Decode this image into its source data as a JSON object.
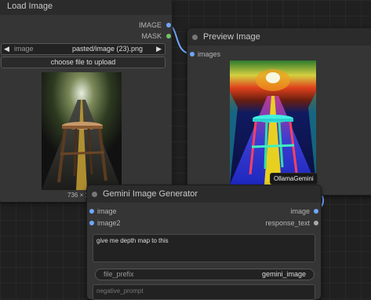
{
  "load_image": {
    "title": "Load Image",
    "outputs": [
      "IMAGE",
      "MASK"
    ],
    "image_widget_label": "image",
    "image_widget_value": "pasted/image (23).png",
    "upload_button": "choose file to upload",
    "size_label": "736 × 1"
  },
  "preview_image": {
    "title": "Preview Image",
    "input": "images",
    "badge": "OllamaGemini"
  },
  "gemini": {
    "title": "Gemini Image Generator",
    "inputs": [
      "image",
      "image2"
    ],
    "outputs": [
      "image",
      "response_text"
    ],
    "prompt": "give me depth map to this",
    "file_prefix_label": "file_prefix",
    "file_prefix_value": "gemini_image",
    "negative_prompt_placeholder": "negative_prompt"
  },
  "colors": {
    "image_socket": "#6fa8ff",
    "mask_socket": "#73c56a",
    "link": "#6fa8ff"
  }
}
